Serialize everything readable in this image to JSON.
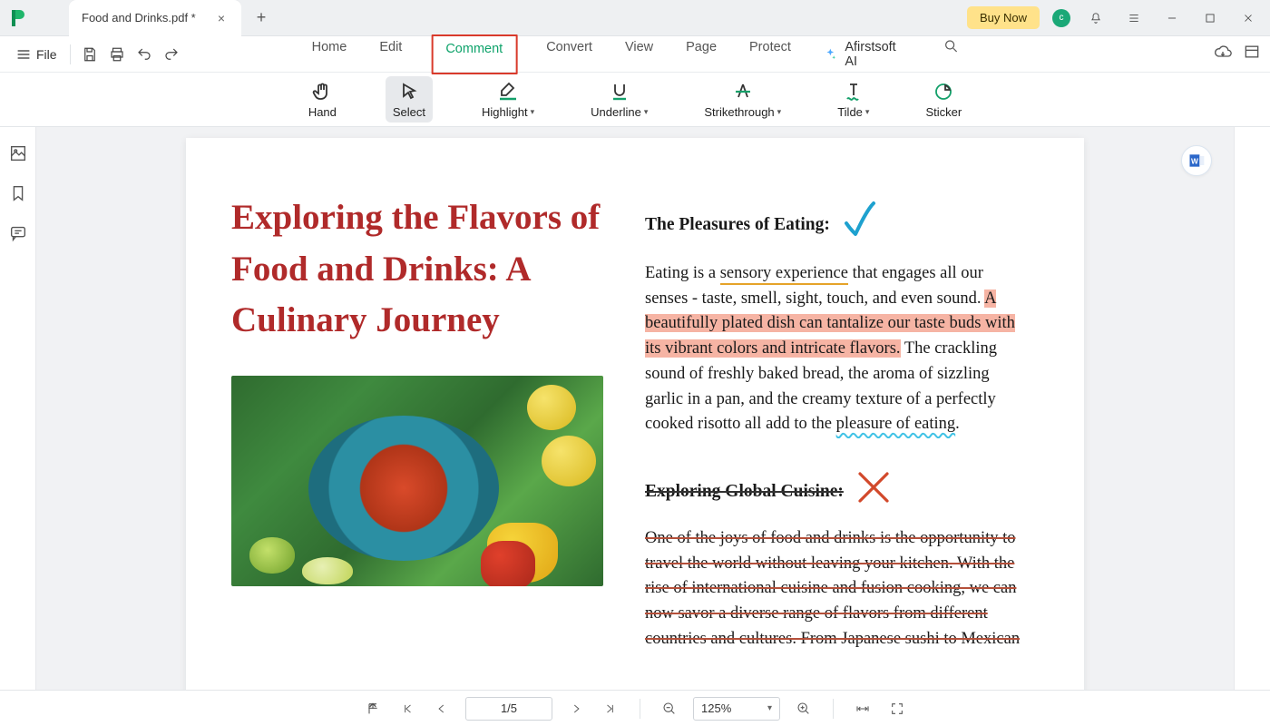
{
  "titlebar": {
    "tab_title": "Food and Drinks.pdf *",
    "buy_now": "Buy Now",
    "avatar_letter": "c"
  },
  "filerow": {
    "file_label": "File",
    "ai_label": "Afirstsoft AI"
  },
  "menu": {
    "home": "Home",
    "edit": "Edit",
    "comment": "Comment",
    "convert": "Convert",
    "view": "View",
    "page": "Page",
    "protect": "Protect"
  },
  "ribbon": {
    "hand": "Hand",
    "select": "Select",
    "highlight": "Highlight",
    "underline": "Underline",
    "strikethrough": "Strikethrough",
    "tilde": "Tilde",
    "sticker": "Sticker"
  },
  "document": {
    "title": "Exploring the Flavors of Food and Drinks: A Culinary Journey",
    "section1_heading": "The Pleasures of Eating:",
    "p1_before": "Eating is a ",
    "p1_underlined": "sensory experience",
    "p1_mid": " that engages all our senses - taste, smell, sight, touch, and even sound. ",
    "p1_highlight": "A beautifully plated dish can tantalize our taste buds with its vibrant colors and intricate flavors.",
    "p1_after_hl": " The crackling sound of freshly baked bread, the aroma of sizzling garlic in a pan, and the creamy texture of a perfectly cooked risotto all add to the ",
    "p1_wavy": "pleasure of eating",
    "p1_end": ".",
    "section2_heading": "Exploring Global Cuisine:",
    "p2": "One of the joys of food and drinks is the opportunity to travel the world without leaving your kitchen. With the rise of international cuisine and fusion cooking, we can now savor a diverse range of flavors from different countries and cultures. From Japanese sushi to Mexican"
  },
  "statusbar": {
    "page": "1/5",
    "zoom": "125%"
  }
}
